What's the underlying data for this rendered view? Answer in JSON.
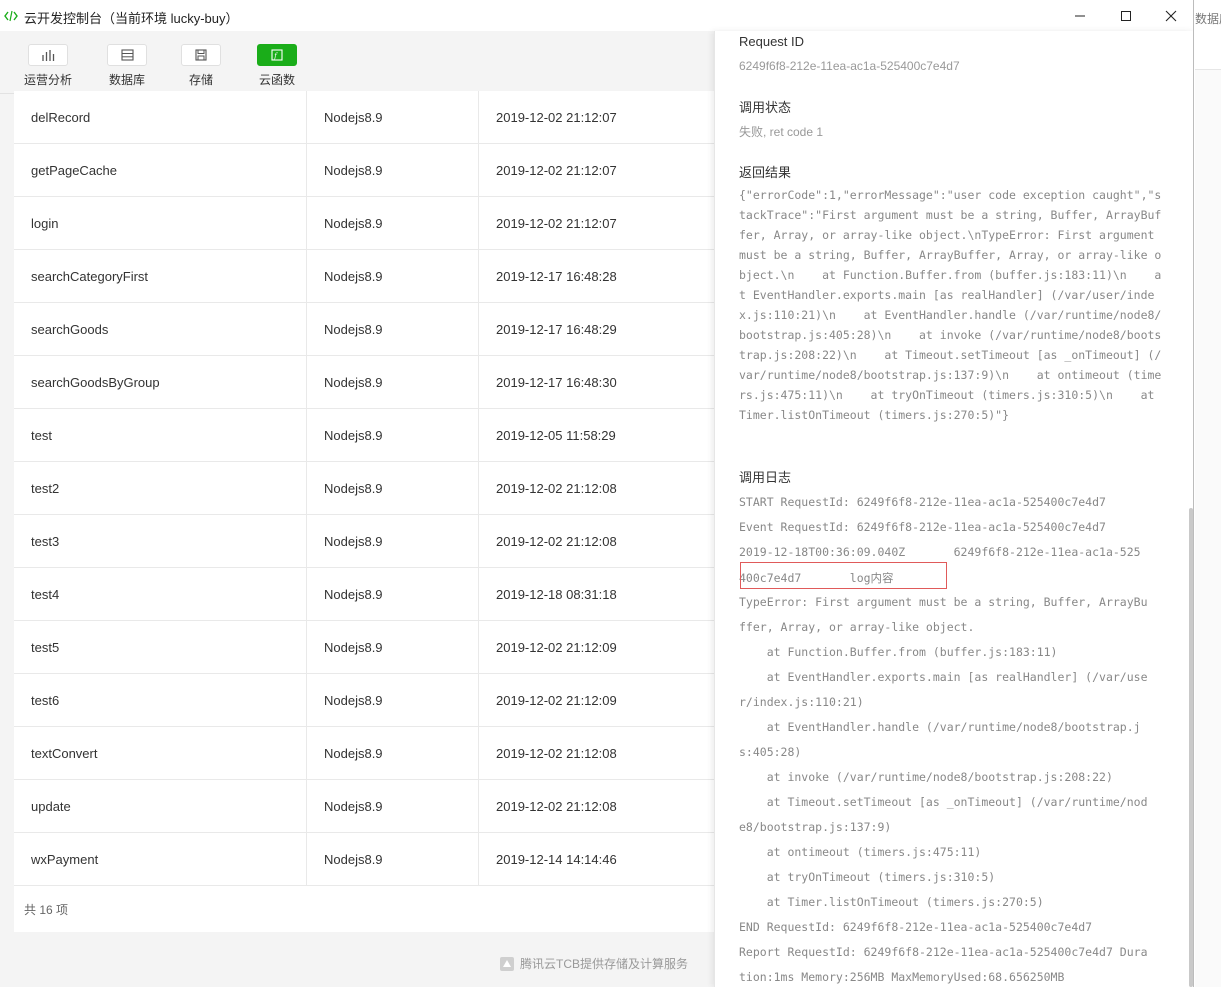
{
  "window": {
    "title": "云开发控制台（当前环境 lucky-buy）"
  },
  "toolbar": {
    "items": [
      {
        "label": "运营分析",
        "icon": "bar-chart-icon"
      },
      {
        "label": "数据库",
        "icon": "database-icon"
      },
      {
        "label": "存储",
        "icon": "storage-icon"
      },
      {
        "label": "云函数",
        "icon": "cloud-function-icon",
        "active": true
      }
    ]
  },
  "table": {
    "rows": [
      {
        "name": "delRecord",
        "runtime": "Nodejs8.9",
        "time": "2019-12-02 21:12:07"
      },
      {
        "name": "getPageCache",
        "runtime": "Nodejs8.9",
        "time": "2019-12-02 21:12:07"
      },
      {
        "name": "login",
        "runtime": "Nodejs8.9",
        "time": "2019-12-02 21:12:07"
      },
      {
        "name": "searchCategoryFirst",
        "runtime": "Nodejs8.9",
        "time": "2019-12-17 16:48:28"
      },
      {
        "name": "searchGoods",
        "runtime": "Nodejs8.9",
        "time": "2019-12-17 16:48:29"
      },
      {
        "name": "searchGoodsByGroup",
        "runtime": "Nodejs8.9",
        "time": "2019-12-17 16:48:30"
      },
      {
        "name": "test",
        "runtime": "Nodejs8.9",
        "time": "2019-12-05 11:58:29"
      },
      {
        "name": "test2",
        "runtime": "Nodejs8.9",
        "time": "2019-12-02 21:12:08"
      },
      {
        "name": "test3",
        "runtime": "Nodejs8.9",
        "time": "2019-12-02 21:12:08"
      },
      {
        "name": "test4",
        "runtime": "Nodejs8.9",
        "time": "2019-12-18 08:31:18"
      },
      {
        "name": "test5",
        "runtime": "Nodejs8.9",
        "time": "2019-12-02 21:12:09"
      },
      {
        "name": "test6",
        "runtime": "Nodejs8.9",
        "time": "2019-12-02 21:12:09"
      },
      {
        "name": "textConvert",
        "runtime": "Nodejs8.9",
        "time": "2019-12-02 21:12:08"
      },
      {
        "name": "update",
        "runtime": "Nodejs8.9",
        "time": "2019-12-02 21:12:08"
      },
      {
        "name": "wxPayment",
        "runtime": "Nodejs8.9",
        "time": "2019-12-14 14:14:46"
      }
    ],
    "total": "共 16 项"
  },
  "footer": {
    "tcb": "腾讯云TCB提供存储及计算服务"
  },
  "panel": {
    "request_id_label": "Request ID",
    "request_id": "6249f6f8-212e-11ea-ac1a-525400c7e4d7",
    "status_label": "调用状态",
    "status": "失败, ret code 1",
    "result_label": "返回结果",
    "result": "{\"errorCode\":1,\"errorMessage\":\"user code exception caught\",\"stackTrace\":\"First argument must be a string, Buffer, ArrayBuffer, Array, or array-like object.\\nTypeError: First argument must be a string, Buffer, ArrayBuffer, Array, or array-like object.\\n    at Function.Buffer.from (buffer.js:183:11)\\n    at EventHandler.exports.main [as realHandler] (/var/user/index.js:110:21)\\n    at EventHandler.handle (/var/runtime/node8/bootstrap.js:405:28)\\n    at invoke (/var/runtime/node8/bootstrap.js:208:22)\\n    at Timeout.setTimeout [as _onTimeout] (/var/runtime/node8/bootstrap.js:137:9)\\n    at ontimeout (timers.js:475:11)\\n    at tryOnTimeout (timers.js:310:5)\\n    at Timer.listOnTimeout (timers.js:270:5)\"}",
    "log_label": "调用日志",
    "log_lines": [
      "START RequestId: 6249f6f8-212e-11ea-ac1a-525400c7e4d7",
      "Event RequestId: 6249f6f8-212e-11ea-ac1a-525400c7e4d7",
      "2019-12-18T00:36:09.040Z       6249f6f8-212e-11ea-ac1a-525",
      "400c7e4d7       log内容",
      "TypeError: First argument must be a string, Buffer, ArrayBu",
      "ffer, Array, or array-like object.",
      "    at Function.Buffer.from (buffer.js:183:11)",
      "    at EventHandler.exports.main [as realHandler] (/var/use",
      "r/index.js:110:21)",
      "    at EventHandler.handle (/var/runtime/node8/bootstrap.j",
      "s:405:28)",
      "    at invoke (/var/runtime/node8/bootstrap.js:208:22)",
      "    at Timeout.setTimeout [as _onTimeout] (/var/runtime/nod",
      "e8/bootstrap.js:137:9)",
      "    at ontimeout (timers.js:475:11)",
      "    at tryOnTimeout (timers.js:310:5)",
      "    at Timer.listOnTimeout (timers.js:270:5)",
      "END RequestId: 6249f6f8-212e-11ea-ac1a-525400c7e4d7",
      "Report RequestId: 6249f6f8-212e-11ea-ac1a-525400c7e4d7 Dura",
      "tion:1ms Memory:256MB MaxMemoryUsed:68.656250MB"
    ]
  },
  "behind": {
    "text": "数据库"
  },
  "colors": {
    "accent": "#1aad19",
    "highlight_box": "#e05a5a"
  }
}
